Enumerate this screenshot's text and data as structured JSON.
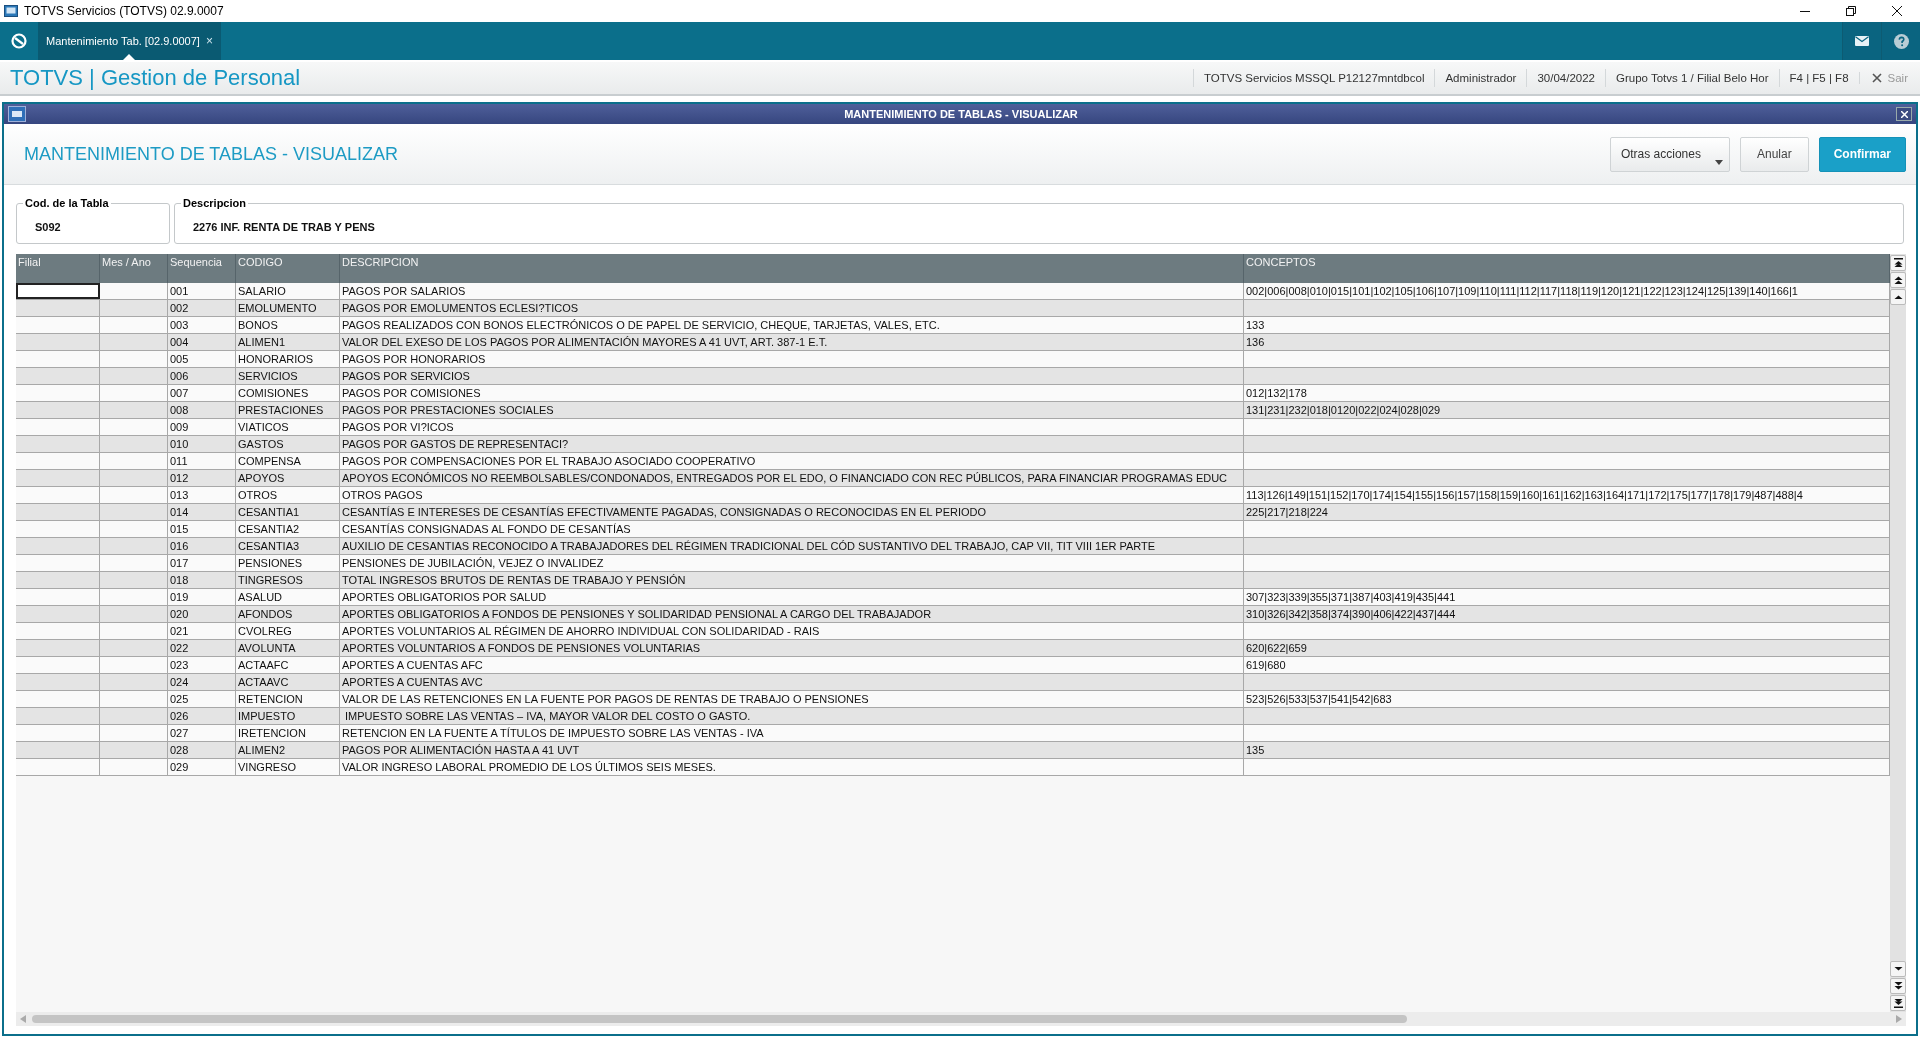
{
  "window": {
    "title": "TOTVS Servicios (TOTVS) 02.9.0007"
  },
  "tabs": [
    {
      "label": "Mantenimiento Tab. [02.9.0007]",
      "close": "×",
      "selected": true
    }
  ],
  "app_header": {
    "brand": "TOTVS | Gestion de Personal",
    "info": [
      "TOTVS Servicios MSSQL P12127mntdbcol",
      "Administrador",
      "30/04/2022",
      "Grupo Totvs 1 / Filial Belo Hor",
      "F4 | F5 | F8"
    ],
    "exit": "Sair"
  },
  "dialog": {
    "title": "MANTENIMIENTO DE TABLAS - VISUALIZAR",
    "heading": "MANTENIMIENTO DE TABLAS - VISUALIZAR",
    "buttons": [
      {
        "label": "Otras acciones",
        "kind": "menu"
      },
      {
        "label": "Anular",
        "kind": "plain"
      },
      {
        "label": "Confirmar",
        "kind": "primary"
      }
    ],
    "fields": [
      {
        "label": "Cod. de la Tabla",
        "value": "S092"
      },
      {
        "label": "Descripcion",
        "value": "2276 INF. RENTA DE TRAB Y PENS"
      }
    ]
  },
  "table": {
    "columns": [
      "Filial",
      "Mes / Ano",
      "Sequencia",
      "CODIGO",
      "DESCRIPCION",
      "CONCEPTOS"
    ],
    "rows": [
      {
        "sequencia": "001",
        "codigo": "SALARIO",
        "descripcion": "PAGOS POR SALARIOS",
        "conceptos": "002|006|008|010|015|101|102|105|106|107|109|110|111|112|117|118|119|120|121|122|123|124|125|139|140|166|1",
        "selected": true
      },
      {
        "sequencia": "002",
        "codigo": "EMOLUMENTO",
        "descripcion": "PAGOS POR EMOLUMENTOS ECLESI?TICOS",
        "selected": false
      },
      {
        "sequencia": "003",
        "codigo": "BONOS",
        "descripcion": "PAGOS REALIZADOS CON BONOS ELECTRÓNICOS O DE PAPEL DE SERVICIO, CHEQUE, TARJETAS, VALES, ETC.",
        "conceptos": "133",
        "selected": false
      },
      {
        "sequencia": "004",
        "codigo": "ALIMEN1",
        "descripcion": "VALOR DEL EXESO DE LOS PAGOS POR ALIMENTACIÓN MAYORES A 41 UVT, ART. 387-1 E.T.",
        "conceptos": "136",
        "selected": false
      },
      {
        "sequencia": "005",
        "codigo": "HONORARIOS",
        "descripcion": "PAGOS POR HONORARIOS",
        "selected": false
      },
      {
        "sequencia": "006",
        "codigo": "SERVICIOS",
        "descripcion": "PAGOS POR SERVICIOS",
        "selected": false
      },
      {
        "sequencia": "007",
        "codigo": "COMISIONES",
        "descripcion": "PAGOS POR COMISIONES",
        "conceptos": "012|132|178",
        "selected": false
      },
      {
        "sequencia": "008",
        "codigo": "PRESTACIONES",
        "descripcion": "PAGOS POR PRESTACIONES SOCIALES",
        "conceptos": "131|231|232|018|0120|022|024|028|029",
        "selected": false
      },
      {
        "sequencia": "009",
        "codigo": "VIATICOS",
        "descripcion": "PAGOS POR VI?ICOS",
        "selected": false
      },
      {
        "sequencia": "010",
        "codigo": "GASTOS",
        "descripcion": "PAGOS POR GASTOS DE REPRESENTACI?",
        "selected": false
      },
      {
        "sequencia": "011",
        "codigo": "COMPENSA",
        "descripcion": "PAGOS POR COMPENSACIONES POR EL TRABAJO ASOCIADO COOPERATIVO",
        "selected": false
      },
      {
        "sequencia": "012",
        "codigo": "APOYOS",
        "descripcion": "APOYOS ECONÓMICOS NO REEMBOLSABLES/CONDONADOS, ENTREGADOS POR EL EDO, O FINANCIADO CON REC PÚBLICOS, PARA FINANCIAR PROGRAMAS EDUC",
        "selected": false
      },
      {
        "sequencia": "013",
        "codigo": "OTROS",
        "descripcion": "OTROS PAGOS",
        "conceptos": "113|126|149|151|152|170|174|154|155|156|157|158|159|160|161|162|163|164|171|172|175|177|178|179|487|488|4",
        "selected": false
      },
      {
        "sequencia": "014",
        "codigo": "CESANTIA1",
        "descripcion": "CESANTÍAS E INTERESES DE CESANTÍAS EFECTIVAMENTE PAGADAS, CONSIGNADAS O RECONOCIDAS EN EL PERIODO",
        "conceptos": "225|217|218|224",
        "selected": false
      },
      {
        "sequencia": "015",
        "codigo": "CESANTIA2",
        "descripcion": "CESANTÍAS CONSIGNADAS AL FONDO DE CESANTÍAS",
        "selected": false
      },
      {
        "sequencia": "016",
        "codigo": "CESANTIA3",
        "descripcion": "AUXILIO DE CESANTIAS RECONOCIDO A TRABAJADORES DEL RÉGIMEN TRADICIONAL DEL CÓD SUSTANTIVO DEL TRABAJO, CAP VII, TIT VIII 1ER PARTE",
        "selected": false
      },
      {
        "sequencia": "017",
        "codigo": "PENSIONES",
        "descripcion": "PENSIONES DE JUBILACIÓN, VEJEZ O INVALIDEZ",
        "selected": false
      },
      {
        "sequencia": "018",
        "codigo": "TINGRESOS",
        "descripcion": "TOTAL INGRESOS BRUTOS DE RENTAS DE TRABAJO Y PENSIÓN",
        "selected": false
      },
      {
        "sequencia": "019",
        "codigo": "ASALUD",
        "descripcion": "APORTES OBLIGATORIOS POR SALUD",
        "conceptos": "307|323|339|355|371|387|403|419|435|441",
        "selected": false
      },
      {
        "sequencia": "020",
        "codigo": "AFONDOS",
        "descripcion": "APORTES OBLIGATORIOS A FONDOS DE PENSIONES Y SOLIDARIDAD PENSIONAL A CARGO DEL TRABAJADOR",
        "conceptos": "310|326|342|358|374|390|406|422|437|444",
        "selected": false
      },
      {
        "sequencia": "021",
        "codigo": "CVOLREG",
        "descripcion": "APORTES VOLUNTARIOS AL RÉGIMEN DE AHORRO INDIVIDUAL CON SOLIDARIDAD - RAIS",
        "selected": false
      },
      {
        "sequencia": "022",
        "codigo": "AVOLUNTA",
        "descripcion": "APORTES VOLUNTARIOS A FONDOS DE PENSIONES VOLUNTARIAS",
        "conceptos": "620|622|659",
        "selected": false
      },
      {
        "sequencia": "023",
        "codigo": "ACTAAFC",
        "descripcion": "APORTES A CUENTAS AFC",
        "conceptos": "619|680",
        "selected": false
      },
      {
        "sequencia": "024",
        "codigo": "ACTAAVC",
        "descripcion": "APORTES A CUENTAS AVC",
        "selected": false
      },
      {
        "sequencia": "025",
        "codigo": "RETENCION",
        "descripcion": "VALOR DE LAS RETENCIONES EN LA FUENTE POR PAGOS DE RENTAS DE TRABAJO O PENSIONES",
        "conceptos": "523|526|533|537|541|542|683",
        "selected": false
      },
      {
        "sequencia": "026",
        "codigo": "IMPUESTO",
        "descripcion": " IMPUESTO SOBRE LAS VENTAS – IVA, MAYOR VALOR DEL COSTO O GASTO.",
        "selected": false
      },
      {
        "sequencia": "027",
        "codigo": "IRETENCION",
        "descripcion": "RETENCION EN LA FUENTE A TÍTULOS DE IMPUESTO SOBRE LAS VENTAS - IVA",
        "selected": false
      },
      {
        "sequencia": "028",
        "codigo": "ALIMEN2",
        "descripcion": "PAGOS POR ALIMENTACIÓN HASTA A 41 UVT",
        "conceptos": "135",
        "selected": false
      },
      {
        "sequencia": "029",
        "codigo": "VINGRESO",
        "descripcion": "VALOR INGRESO LABORAL PROMEDIO DE LOS ÚLTIMOS SEIS MESES.",
        "selected": false
      }
    ]
  }
}
